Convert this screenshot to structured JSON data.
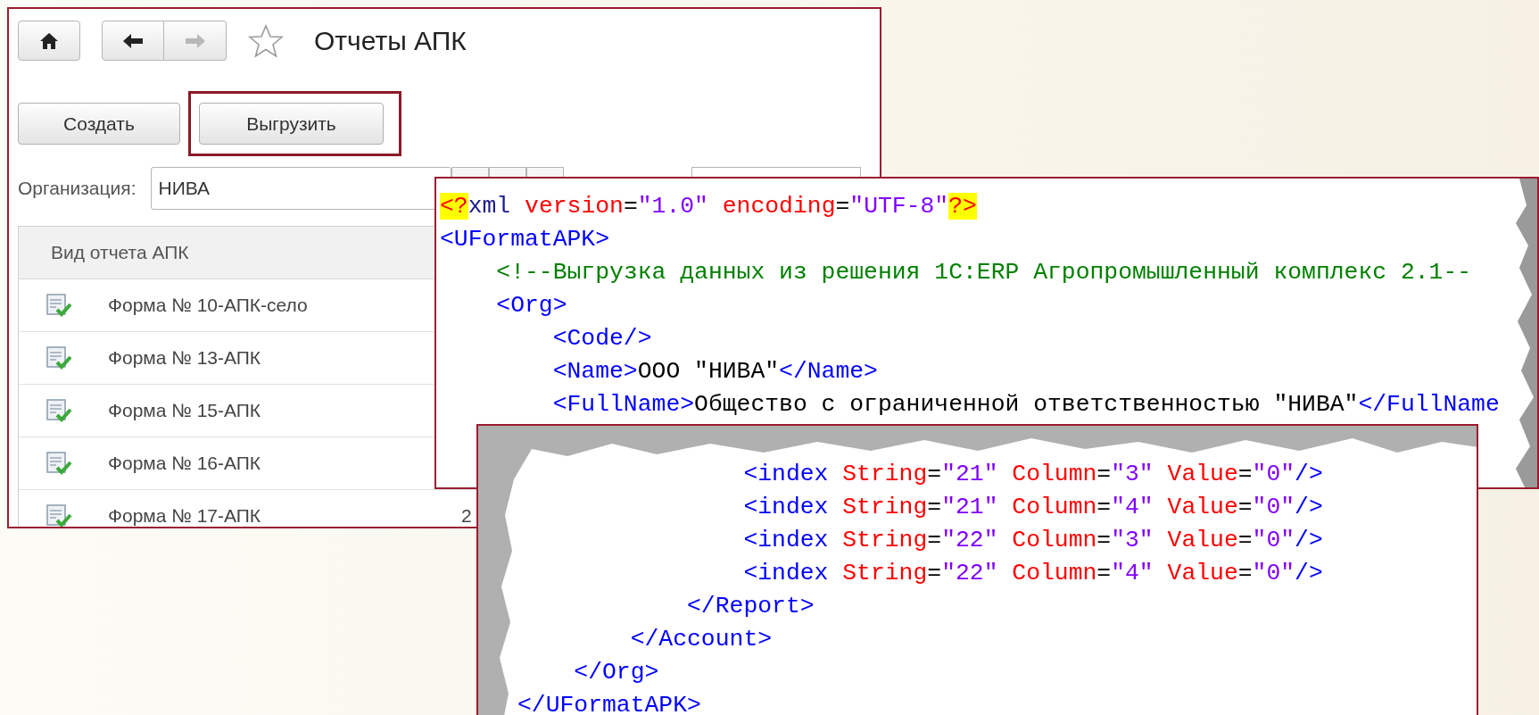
{
  "report_window": {
    "nav": {
      "back": {
        "disabled": false
      },
      "forward": {
        "disabled": true
      }
    },
    "title": "Отчеты АПК",
    "buttons": [
      {
        "label": "Создать",
        "highlighted": false
      },
      {
        "label": "Выгрузить",
        "highlighted": true
      }
    ],
    "organization": {
      "label": "Организация:",
      "value": "НИВА"
    },
    "table": {
      "columns": [
        "Вид отчета АПК"
      ],
      "rows": [
        {
          "name": "Форма № 10-АПК-село"
        },
        {
          "name": "Форма № 13-АПК"
        },
        {
          "name": "Форма № 15-АПК"
        },
        {
          "name": "Форма № 16-АПК"
        },
        {
          "name": "Форма № 17-АПК",
          "column_2": "2"
        }
      ]
    }
  },
  "xml_top": {
    "lines": [
      {
        "tokens": [
          {
            "kind": "pi",
            "text": "<?"
          },
          {
            "kind": "keyword",
            "text": "xml"
          },
          {
            "kind": "attr",
            "text": " version"
          },
          {
            "kind": "punct",
            "text": "="
          },
          {
            "kind": "value",
            "text": "\"1.0\""
          },
          {
            "kind": "attr",
            "text": " encoding"
          },
          {
            "kind": "punct",
            "text": "="
          },
          {
            "kind": "value",
            "text": "\"UTF-8\""
          },
          {
            "kind": "pi",
            "text": "?>"
          }
        ]
      },
      {
        "tokens": [
          {
            "kind": "tag",
            "text": "<UFormatAPK>"
          }
        ],
        "children": [
          {
            "tokens": [
              {
                "kind": "comment",
                "text": "<!--Выгрузка данных из решения 1С:ERP Агропромышленный комплекс 2.1--"
              }
            ]
          },
          {
            "tokens": [
              {
                "kind": "tag",
                "text": "<Org>"
              }
            ],
            "children": [
              {
                "tokens": [
                  {
                    "kind": "tag",
                    "text": "<Code/>"
                  }
                ]
              },
              {
                "tokens": [
                  {
                    "kind": "tag",
                    "text": "<Name>"
                  },
                  {
                    "kind": "text",
                    "text": "ООО \"НИВА\""
                  },
                  {
                    "kind": "tag",
                    "text": "</Name>"
                  }
                ]
              },
              {
                "tokens": [
                  {
                    "kind": "tag",
                    "text": "<FullName>"
                  },
                  {
                    "kind": "text",
                    "text": "Общество с ограниченной ответственностью \"НИВА\""
                  },
                  {
                    "kind": "tag",
                    "text": "</FullName"
                  }
                ]
              }
            ]
          }
        ]
      }
    ]
  },
  "xml_bottom": {
    "lines": [
      {
        "children": [
          {
            "children": [
              {
                "children": [
                  {
                    "children": [
                      {
                        "tokens": [
                          {
                            "kind": "tag",
                            "text": "<index"
                          },
                          {
                            "kind": "attr",
                            "text": " String"
                          },
                          {
                            "kind": "punct",
                            "text": "="
                          },
                          {
                            "kind": "value",
                            "text": "\"21\""
                          },
                          {
                            "kind": "attr",
                            "text": " Column"
                          },
                          {
                            "kind": "punct",
                            "text": "="
                          },
                          {
                            "kind": "value",
                            "text": "\"3\""
                          },
                          {
                            "kind": "attr",
                            "text": " Value"
                          },
                          {
                            "kind": "punct",
                            "text": "="
                          },
                          {
                            "kind": "value",
                            "text": "\"0\""
                          },
                          {
                            "kind": "tag",
                            "text": "/>"
                          }
                        ]
                      },
                      {
                        "tokens": [
                          {
                            "kind": "tag",
                            "text": "<index"
                          },
                          {
                            "kind": "attr",
                            "text": " String"
                          },
                          {
                            "kind": "punct",
                            "text": "="
                          },
                          {
                            "kind": "value",
                            "text": "\"21\""
                          },
                          {
                            "kind": "attr",
                            "text": " Column"
                          },
                          {
                            "kind": "punct",
                            "text": "="
                          },
                          {
                            "kind": "value",
                            "text": "\"4\""
                          },
                          {
                            "kind": "attr",
                            "text": " Value"
                          },
                          {
                            "kind": "punct",
                            "text": "="
                          },
                          {
                            "kind": "value",
                            "text": "\"0\""
                          },
                          {
                            "kind": "tag",
                            "text": "/>"
                          }
                        ]
                      },
                      {
                        "tokens": [
                          {
                            "kind": "tag",
                            "text": "<index"
                          },
                          {
                            "kind": "attr",
                            "text": " String"
                          },
                          {
                            "kind": "punct",
                            "text": "="
                          },
                          {
                            "kind": "value",
                            "text": "\"22\""
                          },
                          {
                            "kind": "attr",
                            "text": " Column"
                          },
                          {
                            "kind": "punct",
                            "text": "="
                          },
                          {
                            "kind": "value",
                            "text": "\"3\""
                          },
                          {
                            "kind": "attr",
                            "text": " Value"
                          },
                          {
                            "kind": "punct",
                            "text": "="
                          },
                          {
                            "kind": "value",
                            "text": "\"0\""
                          },
                          {
                            "kind": "tag",
                            "text": "/>"
                          }
                        ]
                      },
                      {
                        "tokens": [
                          {
                            "kind": "tag",
                            "text": "<index"
                          },
                          {
                            "kind": "attr",
                            "text": " String"
                          },
                          {
                            "kind": "punct",
                            "text": "="
                          },
                          {
                            "kind": "value",
                            "text": "\"22\""
                          },
                          {
                            "kind": "attr",
                            "text": " Column"
                          },
                          {
                            "kind": "punct",
                            "text": "="
                          },
                          {
                            "kind": "value",
                            "text": "\"4\""
                          },
                          {
                            "kind": "attr",
                            "text": " Value"
                          },
                          {
                            "kind": "punct",
                            "text": "="
                          },
                          {
                            "kind": "value",
                            "text": "\"0\""
                          },
                          {
                            "kind": "tag",
                            "text": "/>"
                          }
                        ]
                      }
                    ]
                  },
                  {
                    "tokens": [
                      {
                        "kind": "tag",
                        "text": "</Report>"
                      }
                    ]
                  }
                ]
              },
              {
                "tokens": [
                  {
                    "kind": "tag",
                    "text": "</Account>"
                  }
                ]
              }
            ]
          },
          {
            "tokens": [
              {
                "kind": "tag",
                "text": "</Org>"
              }
            ]
          }
        ]
      },
      {
        "tokens": [
          {
            "kind": "tag",
            "text": "</UFormatAPK>"
          }
        ]
      }
    ]
  }
}
